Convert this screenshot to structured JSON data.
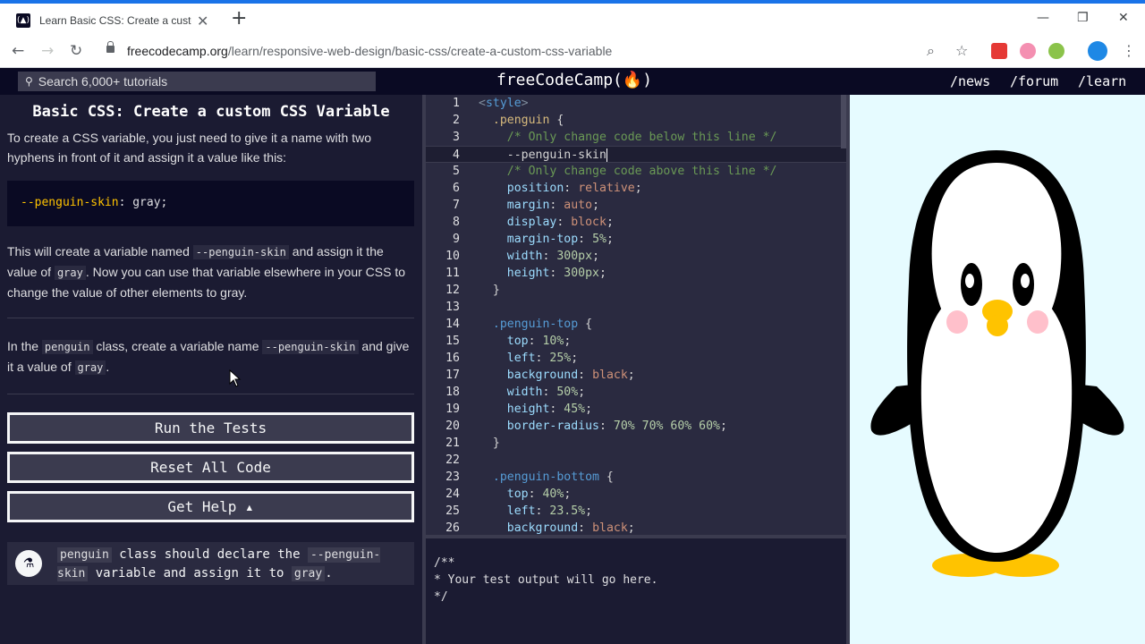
{
  "browser": {
    "tab_title": "Learn Basic CSS: Create a custom CSS Variable | freeCodeCamp.org",
    "url_host": "freecodecamp.org",
    "url_path": "/learn/responsive-web-design/basic-css/create-a-custom-css-variable",
    "icons": [
      "back-icon",
      "forward-icon",
      "reload-icon",
      "lock-icon",
      "zoom-icon",
      "star-icon",
      "more-icon"
    ]
  },
  "nav": {
    "search_placeholder": "Search 6,000+ tutorials",
    "brand": "freeCodeCamp(🔥)",
    "links": [
      "/news",
      "/forum",
      "/learn"
    ]
  },
  "lesson": {
    "title": "Basic CSS: Create a custom CSS Variable",
    "intro": "To create a CSS variable, you just need to give it a name with two hyphens in front of it and assign it a value like this:",
    "example_prop": "--penguin-skin",
    "example_rest": ": gray;",
    "p2_a": "This will create a variable named ",
    "p2_code1": "--penguin-skin",
    "p2_b": " and assign it the value of ",
    "p2_code2": "gray",
    "p2_c": ". Now you can use that variable elsewhere in your CSS to change the value of other elements to gray.",
    "p3_a": "In the ",
    "p3_code1": "penguin",
    "p3_b": " class, create a variable name ",
    "p3_code2": "--penguin-skin",
    "p3_c": " and give it a value of ",
    "p3_code3": "gray",
    "p3_d": ".",
    "buttons": {
      "run": "Run the Tests",
      "reset": "Reset All Code",
      "help": "Get Help ▴"
    },
    "test": {
      "code1": "penguin",
      "text1": " class should declare the ",
      "code2": "--penguin-skin",
      "text2": " variable and assign it to ",
      "code3": "gray",
      "text3": "."
    }
  },
  "editor": {
    "line_numbers": [
      "1",
      "2",
      "3",
      "4",
      "5",
      "6",
      "7",
      "8",
      "9",
      "10",
      "11",
      "12",
      "13",
      "14",
      "15",
      "16",
      "17",
      "18",
      "19",
      "20",
      "21",
      "22",
      "23",
      "24",
      "25",
      "26"
    ],
    "tag_open": "<",
    "tag_name": "style",
    "tag_close": ">",
    "l2_sel": ".penguin",
    "l2_brace": " {",
    "comment_below": "/* Only change code below this line */",
    "l4_code": "--penguin-skin",
    "comment_above": "/* Only change code above this line */",
    "block1": [
      {
        "prop": "position",
        "val": "relative",
        "kind": "val"
      },
      {
        "prop": "margin",
        "val": "auto",
        "kind": "val"
      },
      {
        "prop": "display",
        "val": "block",
        "kind": "val"
      },
      {
        "prop": "margin-top",
        "val": "5%",
        "kind": "num"
      },
      {
        "prop": "width",
        "val": "300px",
        "kind": "num"
      },
      {
        "prop": "height",
        "val": "300px",
        "kind": "num"
      }
    ],
    "close_brace": "}",
    "l14_sel": ".penguin-top",
    "block2": [
      {
        "prop": "top",
        "val": "10%",
        "kind": "num"
      },
      {
        "prop": "left",
        "val": "25%",
        "kind": "num"
      },
      {
        "prop": "background",
        "val": "black",
        "kind": "val"
      },
      {
        "prop": "width",
        "val": "50%",
        "kind": "num"
      },
      {
        "prop": "height",
        "val": "45%",
        "kind": "num"
      },
      {
        "prop": "border-radius",
        "val": "70% 70% 60% 60%",
        "kind": "num"
      }
    ],
    "l23_sel": ".penguin-bottom",
    "block3": [
      {
        "prop": "top",
        "val": "40%",
        "kind": "num"
      },
      {
        "prop": "left",
        "val": "23.5%",
        "kind": "num"
      },
      {
        "prop": "background",
        "val": "black",
        "kind": "val"
      }
    ],
    "output": "/**\n* Your test output will go here.\n*/"
  },
  "colors": {
    "bg": "#1b1b32",
    "nav": "#0a0a23",
    "preview_bg": "#e6fbff",
    "beak": "#ffc300",
    "cheeks": "#ffc0cb"
  }
}
